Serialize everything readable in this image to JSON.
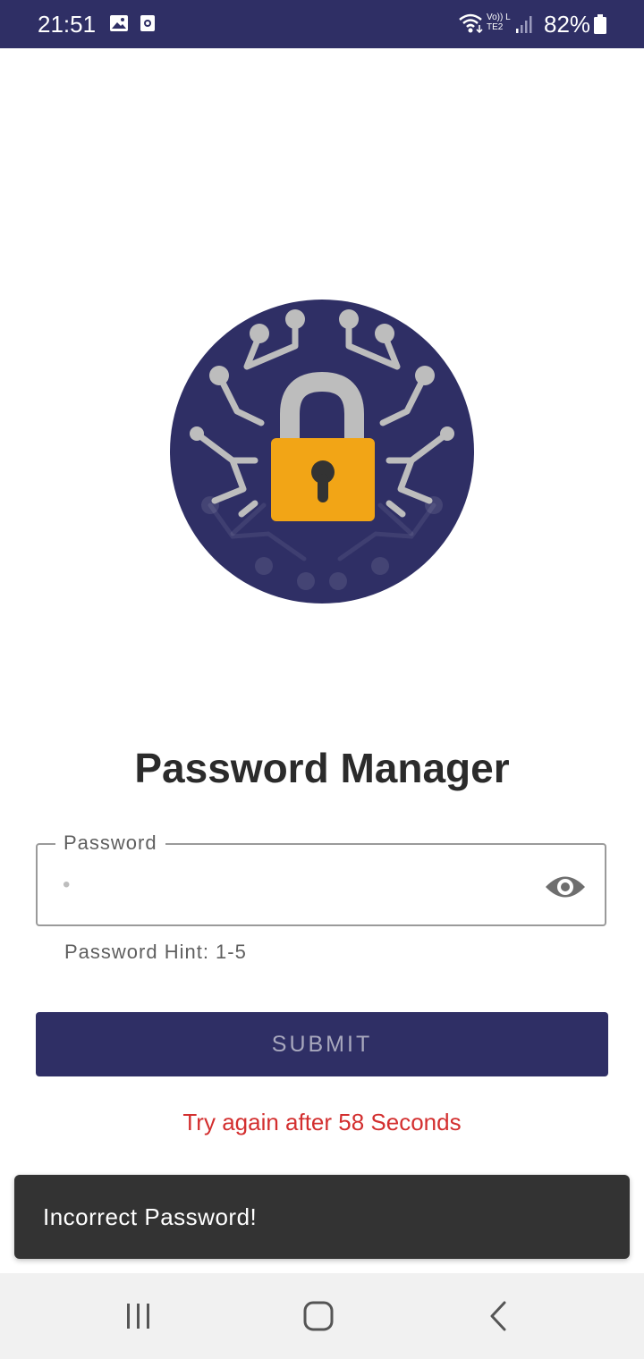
{
  "status_bar": {
    "time": "21:51",
    "battery": "82%",
    "network_label": "Vo)) LTE2",
    "icons": [
      "gallery-icon",
      "screen-record-icon",
      "wifi-icon",
      "signal-icon",
      "battery-icon"
    ]
  },
  "app": {
    "title": "Password Manager",
    "logo_icon": "circuit-padlock-logo"
  },
  "password_field": {
    "label": "Password",
    "value": "•",
    "toggle_icon": "eye-icon"
  },
  "hint": "Password Hint: 1-5",
  "submit": {
    "label": "SUBMIT"
  },
  "retry_message": "Try again after 58 Seconds",
  "snackbar": {
    "message": "Incorrect Password!"
  },
  "nav_bar": {
    "icons": [
      "recents-icon",
      "home-icon",
      "back-icon"
    ]
  },
  "colors": {
    "primary": "#2f2f65",
    "error": "#d32f2f",
    "lock_body": "#f2a516",
    "lock_shackle": "#bdbdbd"
  }
}
